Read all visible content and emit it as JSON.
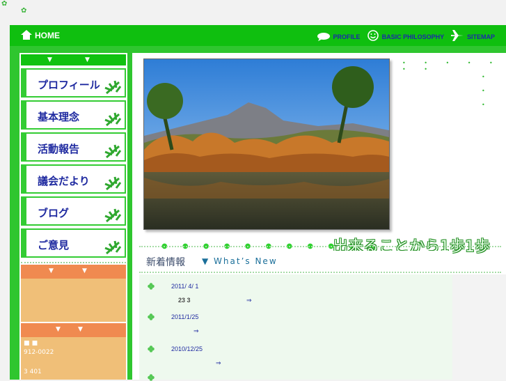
{
  "topbar": {
    "home": "HOME",
    "profile": "PROFILE",
    "philosophy": "BASIC PHILOSOPHY",
    "sitemap": "SITEMAP"
  },
  "sidebar": {
    "arrows": "▼",
    "menu": [
      "プロフィール",
      "基本理念",
      "活動報告",
      "議会だより",
      "ブログ",
      "ご意見"
    ],
    "contact_lines": [
      "■ ■",
      "912-0022",
      "3 401"
    ]
  },
  "hero": {
    "catchphrase": "出来ることから1歩1歩",
    "dots": "● ● ● ● ● ● ● ● ● ● ●"
  },
  "news": {
    "title": "新着情報",
    "subtitle": "▼ What’s New",
    "items": [
      {
        "date": "2011/ 4/ 1",
        "line": "23 3",
        "arrow": "⇒"
      },
      {
        "date": "2011/1/25",
        "arrow": "⇒"
      },
      {
        "date": "2010/12/25",
        "arrow": "⇒"
      }
    ]
  },
  "colors": {
    "green": "#0fbf0f",
    "navy": "#1f2aa0",
    "orange": "#f08a50"
  }
}
